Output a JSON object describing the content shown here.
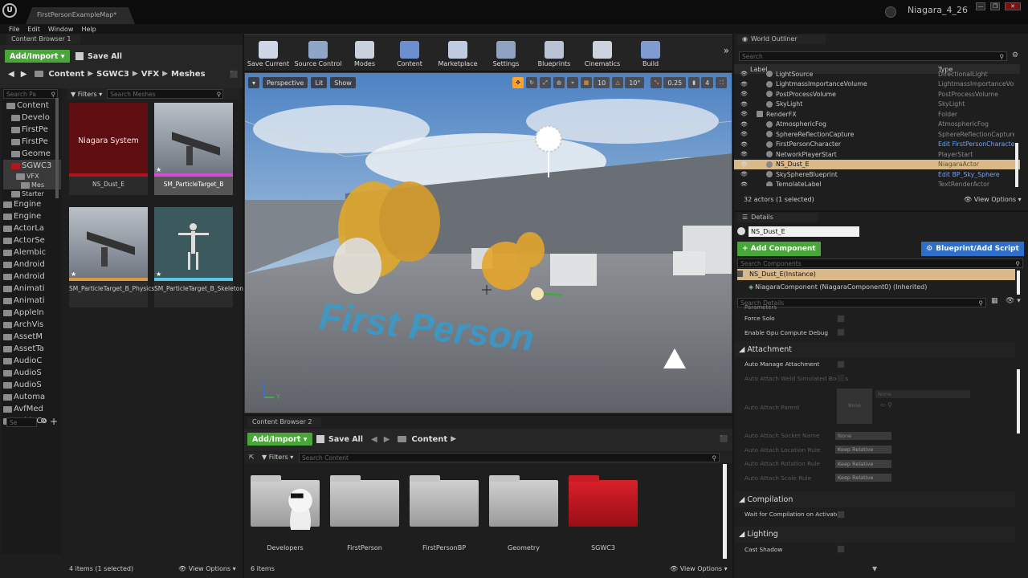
{
  "window": {
    "doc_tab": "FirstPersonExampleMap*",
    "project": "Niagara_4_26",
    "controls": [
      "—",
      "❐",
      "✕"
    ]
  },
  "menu": [
    "File",
    "Edit",
    "Window",
    "Help"
  ],
  "cb1": {
    "tab": "Content Browser 1",
    "add_import": "Add/Import",
    "save_all": "Save All",
    "path": [
      "Content",
      "SGWC3",
      "VFX",
      "Meshes"
    ],
    "filters": "Filters",
    "search_placeholder": "Search Meshes",
    "tree_search_placeholder": "Search Pa",
    "tree": [
      "Content",
      "Develo",
      "FirstPe",
      "FirstPe",
      "Geome",
      "SGWC3",
      "VFX",
      "Mes",
      "Starter",
      "Engine",
      "Engine",
      "ActorLa",
      "ActorSe",
      "Alembic",
      "Android",
      "Android",
      "Animati",
      "Animati",
      "AppleIn",
      "ArchVis",
      "AssetM",
      "AssetTa",
      "AudioC",
      "AudioS",
      "AudioS",
      "Automa",
      "AvfMed",
      "CableCo"
    ],
    "assets": [
      {
        "name": "NS_Dust_E",
        "thumb_label": "Niagara System"
      },
      {
        "name": "SM_ParticleTarget_B"
      },
      {
        "name": "SM_ParticleTarget_B_PhysicsAsset"
      },
      {
        "name": "SM_ParticleTarget_B_Skeleton"
      }
    ],
    "status": "4 items (1 selected)",
    "view_options": "View Options"
  },
  "toolbar": [
    {
      "label": "Save Current",
      "color": "#cfd6e6"
    },
    {
      "label": "Source Control",
      "color": "#8fa6c9"
    },
    {
      "label": "Modes",
      "color": "#c9d1dd"
    },
    {
      "label": "Content",
      "color": "#6c8fd0"
    },
    {
      "label": "Marketplace",
      "color": "#bfcbe0"
    },
    {
      "label": "Settings",
      "color": "#8fa2c0"
    },
    {
      "label": "Blueprints",
      "color": "#b9c3d5"
    },
    {
      "label": "Cinematics",
      "color": "#cdd3de"
    },
    {
      "label": "Build",
      "color": "#7f9bd1"
    }
  ],
  "viewport": {
    "perspective": "Perspective",
    "lit": "Lit",
    "show": "Show",
    "grid_snap": "10",
    "rot_snap": "10°",
    "scale_snap": "0.25",
    "cam_speed": "4",
    "floor_text": "First Person",
    "axis_z": "Z",
    "axis_y": "Y"
  },
  "cb2": {
    "tab": "Content Browser 2",
    "add_import": "Add/Import",
    "save_all": "Save All",
    "path": "Content",
    "filters": "Filters",
    "search_placeholder": "Search Content",
    "folders": [
      "Developers",
      "FirstPerson",
      "FirstPersonBP",
      "Geometry",
      "SGWC3"
    ],
    "status": "6 items",
    "view_options": "View Options"
  },
  "outliner": {
    "tab": "World Outliner",
    "search_placeholder": "Search",
    "col_label": "Label",
    "col_type": "Type",
    "rows": [
      {
        "label": "LightSource",
        "type": "DirectionalLight"
      },
      {
        "label": "LightmassImportanceVolume",
        "type": "LightmassImportanceVol"
      },
      {
        "label": "PostProcessVolume",
        "type": "PostProcessVolume"
      },
      {
        "label": "SkyLight",
        "type": "SkyLight"
      },
      {
        "label": "RenderFX",
        "type": "Folder"
      },
      {
        "label": "AtmosphericFog",
        "type": "AtmosphericFog"
      },
      {
        "label": "SphereReflectionCapture",
        "type": "SphereReflectionCapture"
      },
      {
        "label": "FirstPersonCharacter",
        "type": "Edit FirstPersonCharacter"
      },
      {
        "label": "NetworkPlayerStart",
        "type": "PlayerStart"
      },
      {
        "label": "NS_Dust_E",
        "type": "NiagaraActor"
      },
      {
        "label": "SkySphereBlueprint",
        "type": "Edit BP_Sky_Sphere"
      },
      {
        "label": "TemplateLabel",
        "type": "TextRenderActor"
      }
    ],
    "status": "32 actors (1 selected)",
    "view_options": "View Options"
  },
  "details": {
    "tab": "Details",
    "name": "NS_Dust_E",
    "add_component": "+ Add Component",
    "blueprint_script": "Blueprint/Add Script",
    "search_components": "Search Components",
    "instance": "NS_Dust_E(Instance)",
    "component": "NiagaraComponent (NiagaraComponent0) (Inherited)",
    "search_details": "Search Details",
    "parameters_header": "Parameters",
    "force_solo": "Force Solo",
    "gpu_debug": "Enable Gpu Compute Debug",
    "attachment": "Attachment",
    "auto_manage": "Auto Manage Attachment",
    "weld": "Auto Attach Weld Simulated Bodies",
    "parent": "Auto Attach Parent",
    "none": "None",
    "socket": "Auto Attach Socket Name",
    "loc_rule": "Auto Attach Location Rule",
    "rot_rule": "Auto Attach Rotation Rule",
    "scale_rule": "Auto Attach Scale Rule",
    "keep_relative": "Keep Relative",
    "compilation": "Compilation",
    "wait_compile": "Wait for Compilation on Activate",
    "lighting": "Lighting",
    "cast_shadow": "Cast Shadow"
  }
}
